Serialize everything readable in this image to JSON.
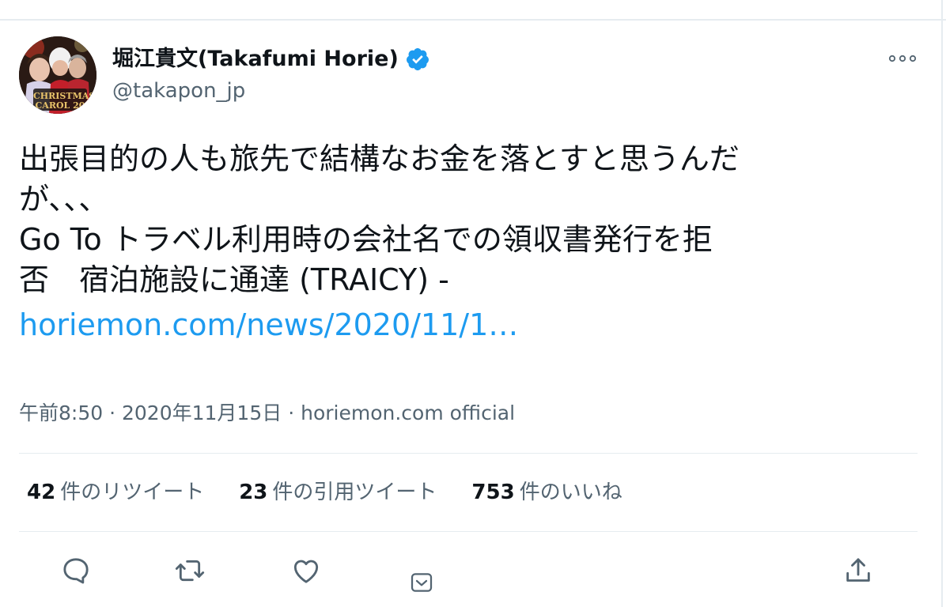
{
  "tweet": {
    "author": {
      "display_name": "堀江貴文(Takafumi Horie)",
      "handle": "@takapon_jp",
      "verified_icon": "verified-badge-icon",
      "avatar_caption_top": "CHRISTMAS",
      "avatar_caption_bottom": "CAROL 20"
    },
    "text_lines": [
      "出張目的の人も旅先で結構なお金を落とすと思うんだ",
      "が、、、",
      "Go To トラベル利用時の会社名での領収書発行を拒",
      "否　宿泊施設に通達 (TRAICY) -"
    ],
    "link": "horiemon.com/news/2020/11/1…",
    "meta": {
      "time": "午前8:50",
      "date": "2020年11月15日",
      "separator": "·",
      "source": "horiemon.com official"
    },
    "stats": [
      {
        "count": "42",
        "label": "件のリツイート"
      },
      {
        "count": "23",
        "label": "件の引用ツイート"
      },
      {
        "count": "753",
        "label": "件のいいね"
      }
    ],
    "actions": [
      "reply-icon",
      "retweet-icon",
      "like-icon",
      "dm-icon",
      "share-icon"
    ]
  },
  "colors": {
    "link": "#1d9bf0",
    "verified": "#1d9bf0",
    "secondary_text": "#536471",
    "primary_text": "#0f1419",
    "divider": "#e6ecf0"
  }
}
